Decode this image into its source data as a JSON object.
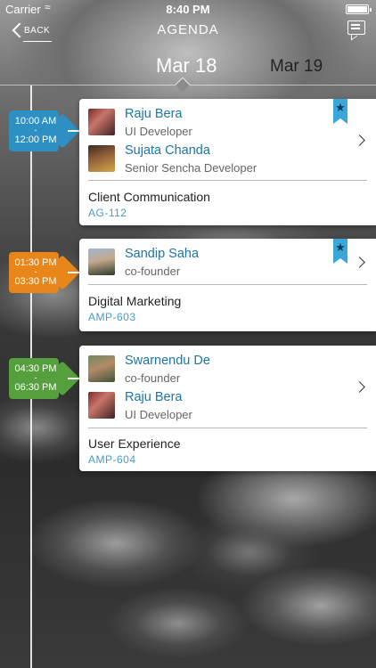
{
  "status_bar": {
    "carrier": "Carrier",
    "time": "8:40 PM"
  },
  "nav": {
    "back_label": "BACK",
    "title": "AGENDA",
    "chat_icon": "chat-icon"
  },
  "date_tabs": [
    {
      "label": "Mar 18",
      "active": true
    },
    {
      "label": "Mar 19",
      "active": false
    }
  ],
  "sessions": [
    {
      "start": "10:00 AM",
      "sep": "-",
      "end": "12:00 PM",
      "color": "#2d8fc2",
      "bookmarked": true,
      "speakers": [
        {
          "name": "Raju Bera",
          "role": "UI Developer"
        },
        {
          "name": "Sujata Chanda",
          "role": "Senior Sencha Developer"
        }
      ],
      "topic": "Client Communication",
      "code": "AG-112"
    },
    {
      "start": "01:30 PM",
      "sep": "-",
      "end": "03:30 PM",
      "color": "#e8861a",
      "bookmarked": true,
      "speakers": [
        {
          "name": "Sandip Saha",
          "role": "co-founder"
        }
      ],
      "topic": "Digital Marketing",
      "code": "AMP-603"
    },
    {
      "start": "04:30 PM",
      "sep": "-",
      "end": "06:30 PM",
      "color": "#55a03c",
      "bookmarked": false,
      "speakers": [
        {
          "name": "Swarnendu De",
          "role": "co-founder"
        },
        {
          "name": "Raju Bera",
          "role": "UI Developer"
        }
      ],
      "topic": "User Experience",
      "code": "AMP-604"
    }
  ]
}
